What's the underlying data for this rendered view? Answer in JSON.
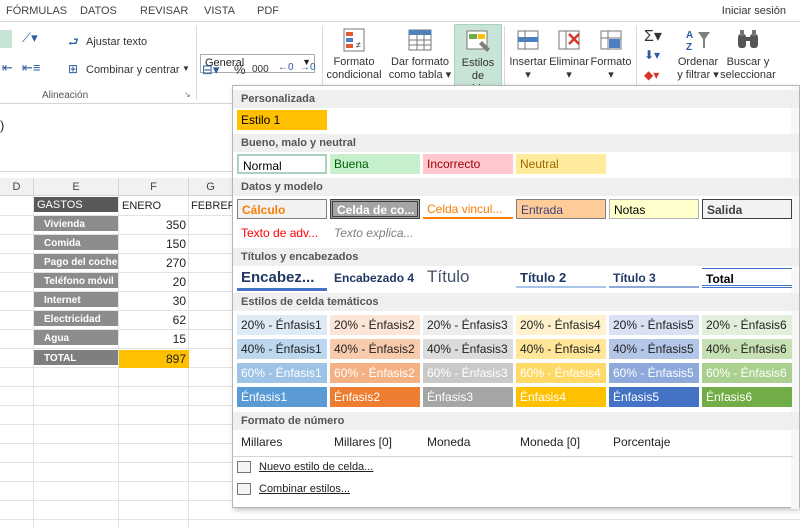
{
  "tabs": [
    "FÓRMULAS",
    "DATOS",
    "REVISAR",
    "VISTA",
    "PDF"
  ],
  "signin": "Iniciar sesión",
  "ribbon": {
    "wrap_text": "Ajustar texto",
    "merge_center": "Combinar y centrar",
    "alignment_group": "Alineación",
    "number_format": "General",
    "percent": "%",
    "thousands": "000",
    "cond_format_1": "Formato",
    "cond_format_2": "condicional",
    "table_format_1": "Dar formato",
    "table_format_2": "como tabla",
    "cell_styles_1": "Estilos de",
    "cell_styles_2": "celda",
    "insert": "Insertar",
    "delete": "Eliminar",
    "format": "Formato",
    "sort_1": "Ordenar",
    "sort_2": "y filtrar",
    "find_1": "Buscar y",
    "find_2": "seleccionar"
  },
  "columns": [
    "D",
    "E",
    "F",
    "G"
  ],
  "sheet": {
    "headers": [
      "GASTOS",
      "ENERO",
      "FEBRERO"
    ],
    "rows": [
      {
        "label": "Vivienda",
        "value": "350"
      },
      {
        "label": "Comida",
        "value": "150"
      },
      {
        "label": "Pago del coche",
        "value": "270"
      },
      {
        "label": "Teléfono móvil",
        "value": "20"
      },
      {
        "label": "Internet",
        "value": "30"
      },
      {
        "label": "Electricidad",
        "value": "62"
      },
      {
        "label": "Agua",
        "value": "15"
      }
    ],
    "total_label": "TOTAL",
    "total_value": "897",
    "formula_fragment": ")"
  },
  "dropdown": {
    "sections": {
      "custom": "Personalizada",
      "good_bad": "Bueno, malo y neutral",
      "data_model": "Datos y modelo",
      "titles": "Títulos y encabezados",
      "themed": "Estilos de celda temáticos",
      "number": "Formato de número"
    },
    "custom": [
      "Estilo 1"
    ],
    "good_bad": [
      "Normal",
      "Buena",
      "Incorrecto",
      "Neutral"
    ],
    "data_model_1": [
      "Cálculo",
      "Celda de co...",
      "Celda vincul...",
      "Entrada",
      "Notas",
      "Salida"
    ],
    "data_model_2": [
      "Texto de adv...",
      "Texto explica..."
    ],
    "titles": [
      "Encabez...",
      "Encabezado 4",
      "Título",
      "Título 2",
      "Título 3",
      "Total"
    ],
    "themed_20": [
      "20% - Énfasis1",
      "20% - Énfasis2",
      "20% - Énfasis3",
      "20% - Énfasis4",
      "20% - Énfasis5",
      "20% - Énfasis6"
    ],
    "themed_40": [
      "40% - Énfasis1",
      "40% - Énfasis2",
      "40% - Énfasis3",
      "40% - Énfasis4",
      "40% - Énfasis5",
      "40% - Énfasis6"
    ],
    "themed_60": [
      "60% - Énfasis1",
      "60% - Énfasis2",
      "60% - Énfasis3",
      "60% - Énfasis4",
      "60% - Énfasis5",
      "60% - Énfasis6"
    ],
    "themed_100": [
      "Énfasis1",
      "Énfasis2",
      "Énfasis3",
      "Énfasis4",
      "Énfasis5",
      "Énfasis6"
    ],
    "number": [
      "Millares",
      "Millares [0]",
      "Moneda",
      "Moneda [0]",
      "Porcentaje"
    ],
    "new_style": "Nuevo estilo de celda...",
    "merge_styles": "Combinar estilos..."
  }
}
